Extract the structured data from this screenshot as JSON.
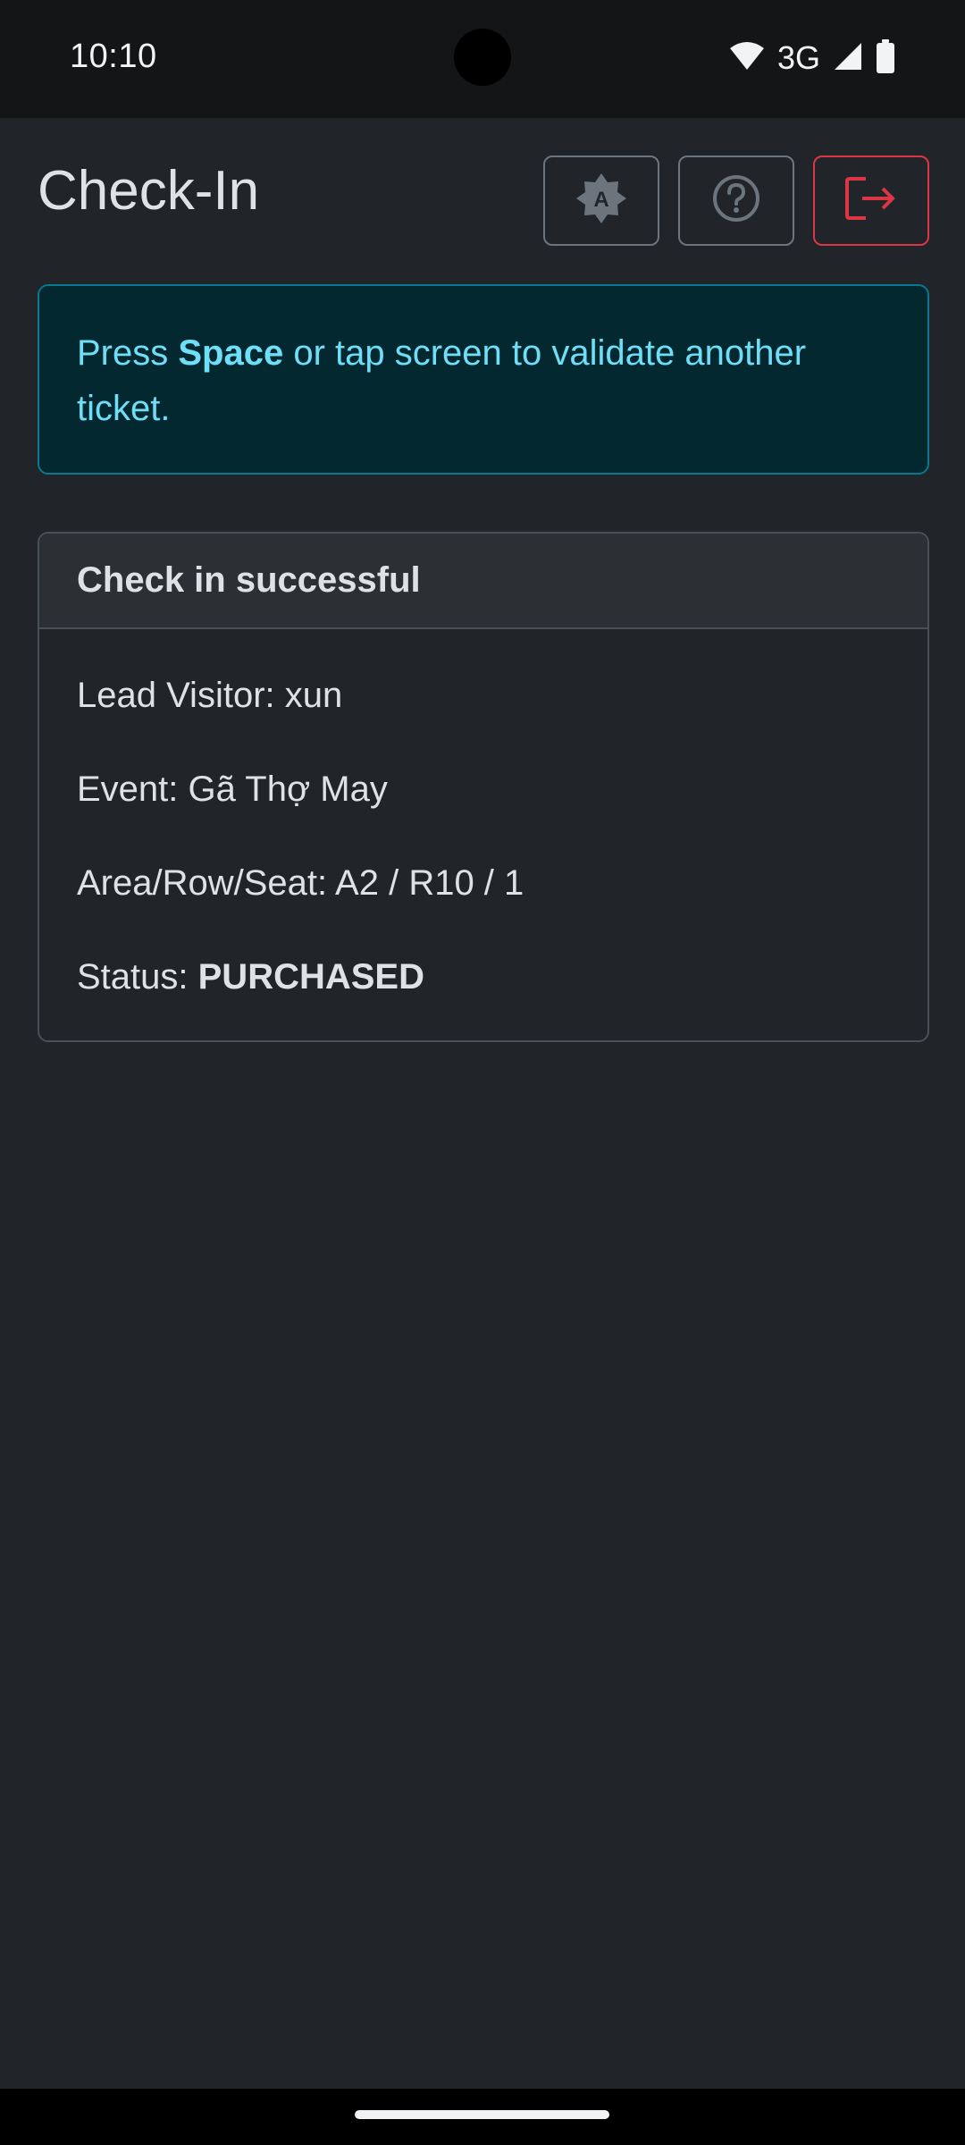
{
  "status_bar": {
    "time": "10:10",
    "network": "3G"
  },
  "header": {
    "title": "Check-In"
  },
  "toolbar": {
    "theme_icon": "auto-theme-icon",
    "help_icon": "question-circle-icon",
    "logout_icon": "logout-icon",
    "logout_color": "#dc3545"
  },
  "alert": {
    "prefix": "Press ",
    "key": "Space",
    "suffix": " or tap screen to validate another ticket."
  },
  "result": {
    "header": "Check in successful",
    "lead_visitor_label": "Lead Visitor: ",
    "lead_visitor": "xun",
    "event_label": "Event: ",
    "event": "Gã Thợ May",
    "seat_label": "Area/Row/Seat: ",
    "seat": "A2 / R10 / 1",
    "status_label": "Status: ",
    "status": "PURCHASED"
  }
}
